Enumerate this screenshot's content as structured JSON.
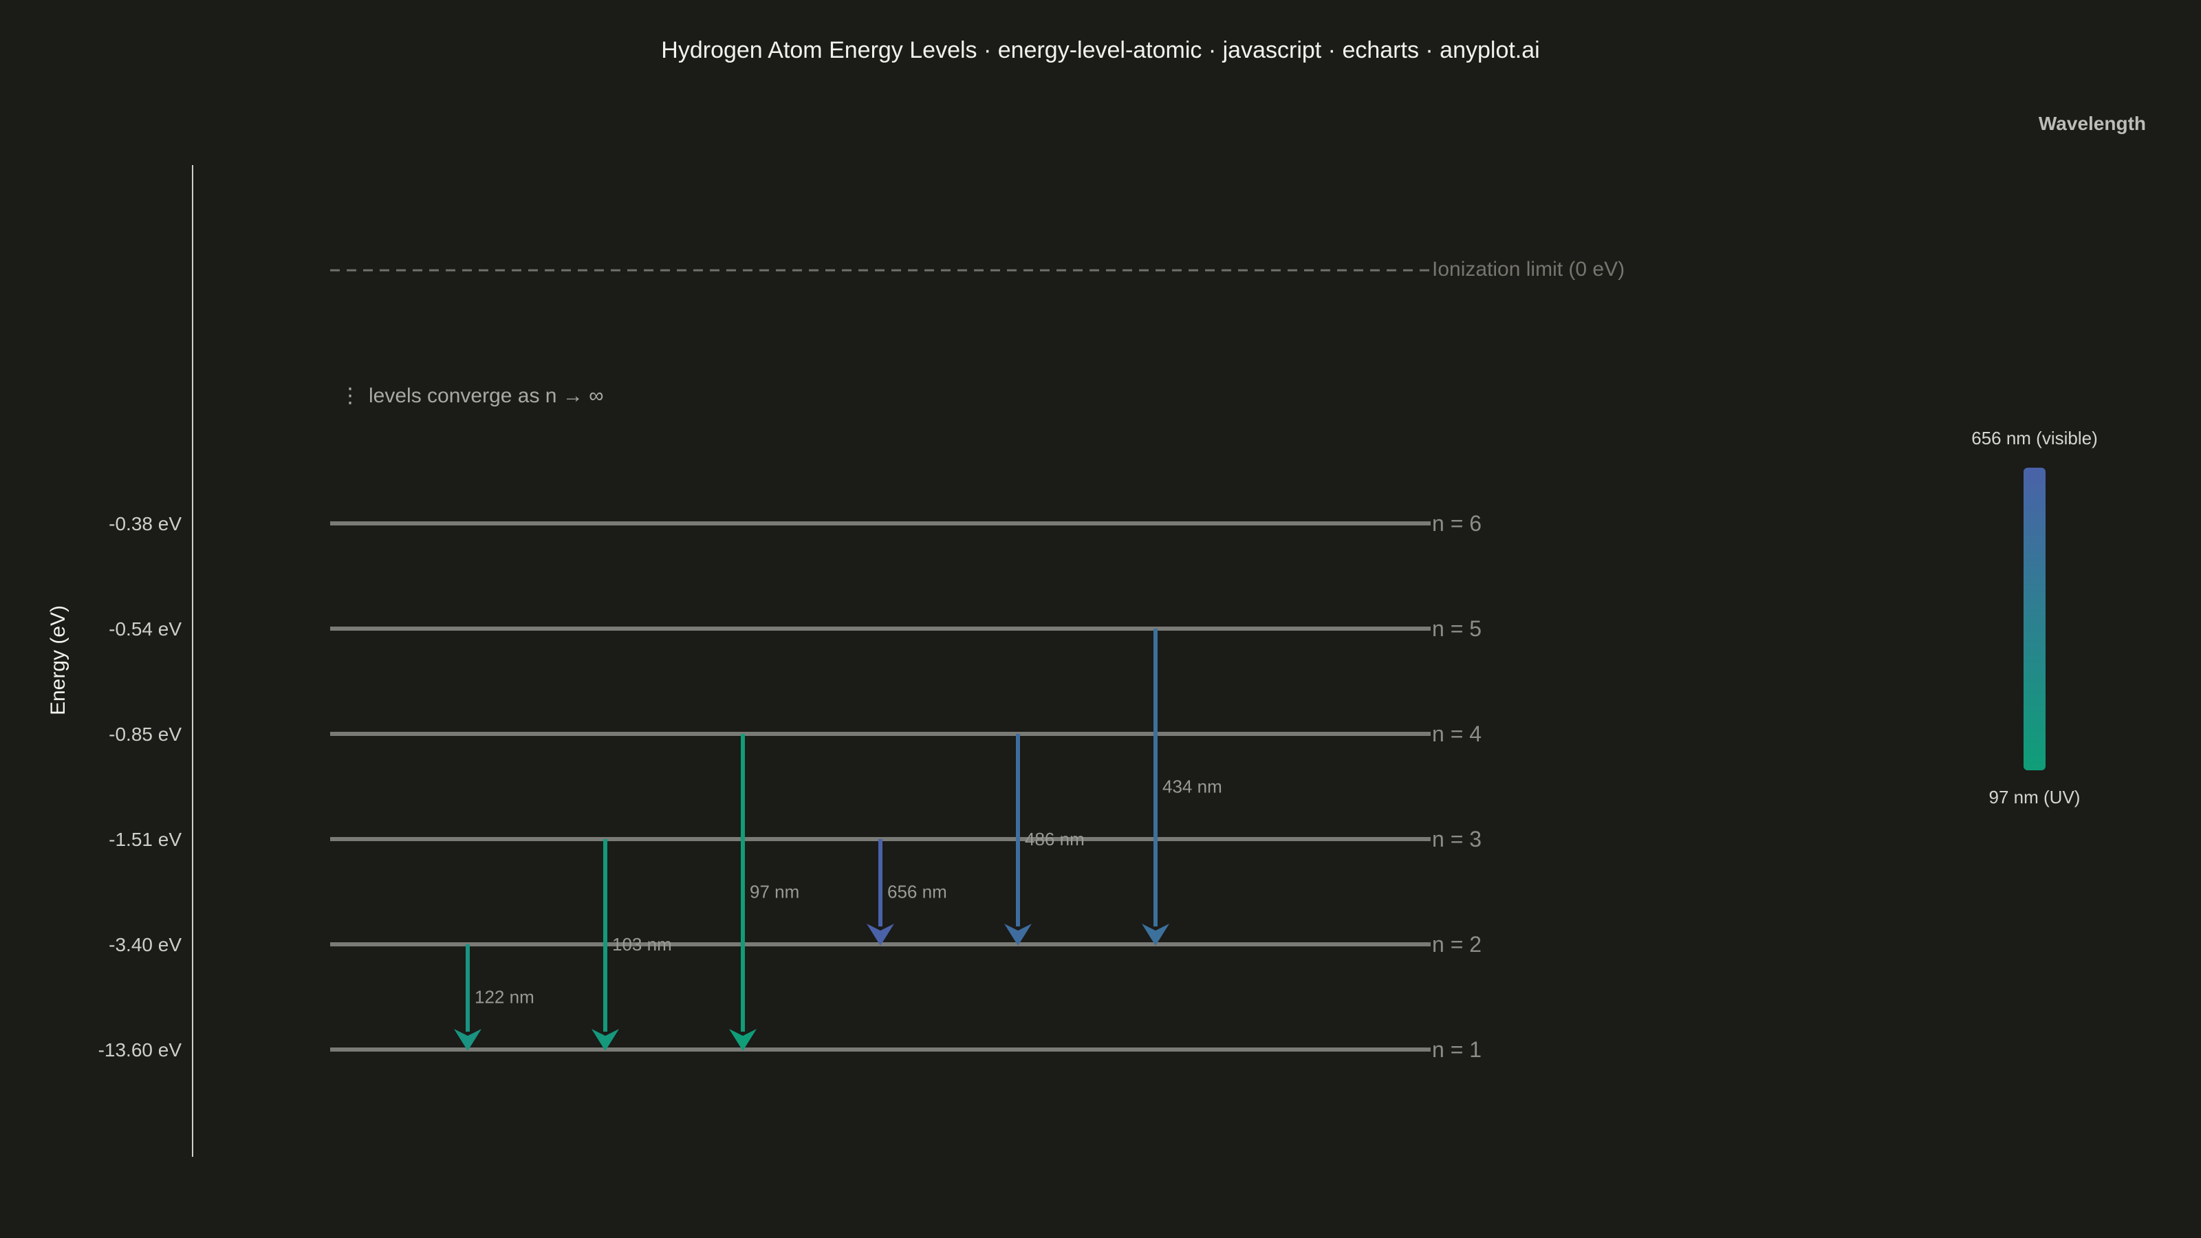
{
  "title": "Hydrogen Atom Energy Levels · energy-level-atomic · javascript · echarts · anyplot.ai",
  "colors": {
    "background": "#1b1b18",
    "level_line": "#7a7a76",
    "visible": "#4a62a8",
    "uv": "#0f9e78"
  },
  "chart_data": {
    "type": "energy-level-diagram",
    "ylabel": "Energy (eV)",
    "ylim": [
      -14.5,
      0.5
    ],
    "y_axis_scale": "compressed (non-linear) level spacing",
    "ionization": {
      "energy": 0,
      "label": "Ionization limit (0 eV)"
    },
    "note": "levels converge as n → ∞",
    "levels": [
      {
        "n": 1,
        "label": "n = 1",
        "energy": -13.6,
        "tick": "-13.60 eV"
      },
      {
        "n": 2,
        "label": "n = 2",
        "energy": -3.4,
        "tick": "-3.40 eV"
      },
      {
        "n": 3,
        "label": "n = 3",
        "energy": -1.51,
        "tick": "-1.51 eV"
      },
      {
        "n": 4,
        "label": "n = 4",
        "energy": -0.85,
        "tick": "-0.85 eV"
      },
      {
        "n": 5,
        "label": "n = 5",
        "energy": -0.54,
        "tick": "-0.54 eV"
      },
      {
        "n": 6,
        "label": "n = 6",
        "energy": -0.38,
        "tick": "-0.38 eV"
      }
    ],
    "transitions": [
      {
        "from": 2,
        "to": 1,
        "wavelength_nm": 122,
        "label": "122 nm"
      },
      {
        "from": 3,
        "to": 1,
        "wavelength_nm": 103,
        "label": "103 nm"
      },
      {
        "from": 4,
        "to": 1,
        "wavelength_nm": 97,
        "label": "97 nm"
      },
      {
        "from": 3,
        "to": 2,
        "wavelength_nm": 656,
        "label": "656 nm"
      },
      {
        "from": 4,
        "to": 2,
        "wavelength_nm": 486,
        "label": "486 nm"
      },
      {
        "from": 5,
        "to": 2,
        "wavelength_nm": 434,
        "label": "434 nm"
      }
    ],
    "legend": {
      "title": "Wavelength",
      "max_label": "656 nm (visible)",
      "min_label": "97 nm (UV)",
      "min_nm": 97,
      "max_nm": 656,
      "placement": "right"
    }
  }
}
